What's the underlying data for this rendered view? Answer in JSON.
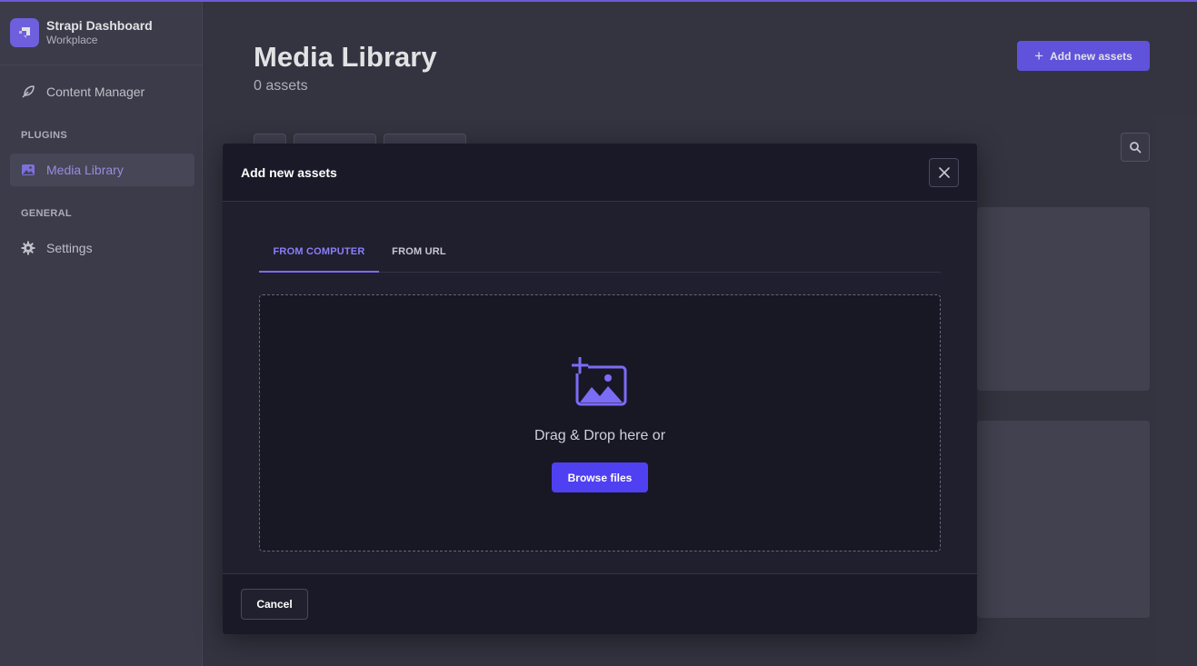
{
  "app": {
    "name": "Strapi Dashboard",
    "workspace": "Workplace",
    "accent_color": "#7b6cf6"
  },
  "sidebar": {
    "items": [
      {
        "label": "Content Manager",
        "icon": "feather-icon"
      },
      {
        "label": "Media Library",
        "icon": "image-icon",
        "active": true
      },
      {
        "label": "Settings",
        "icon": "gear-icon"
      }
    ],
    "sections": {
      "plugins": "PLUGINS",
      "general": "GENERAL"
    }
  },
  "main": {
    "title": "Media Library",
    "subtitle": "0 assets",
    "add_button_label": "Add new assets"
  },
  "modal": {
    "title": "Add new assets",
    "tabs": [
      {
        "label": "FROM COMPUTER",
        "active": true
      },
      {
        "label": "FROM URL",
        "active": false
      }
    ],
    "dropzone_text": "Drag & Drop here or",
    "browse_label": "Browse files",
    "cancel_label": "Cancel"
  }
}
